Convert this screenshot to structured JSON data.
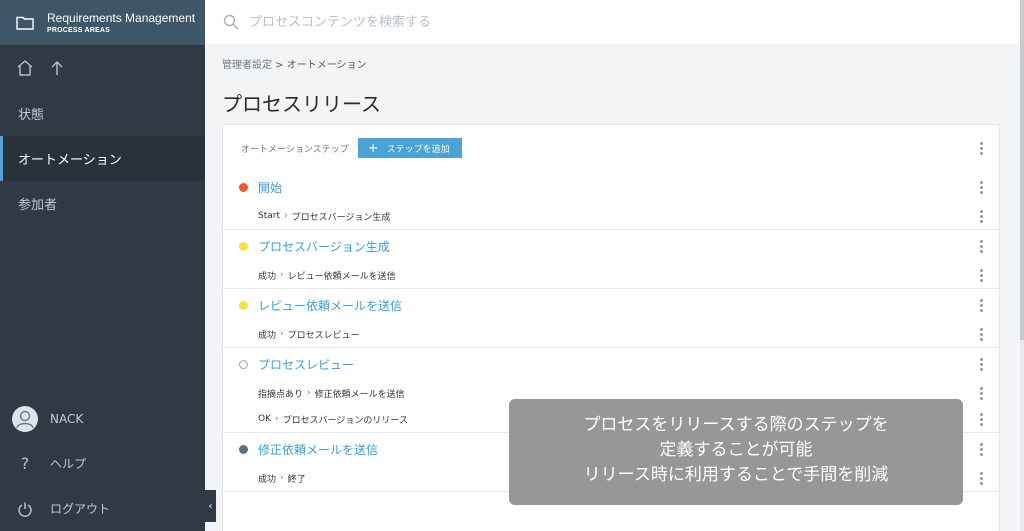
{
  "sidebar": {
    "title": "Requirements Management",
    "subtitle": "PROCESS AREAS",
    "items": [
      {
        "label": "状態"
      },
      {
        "label": "オートメーション"
      },
      {
        "label": "参加者"
      }
    ],
    "user": "NACK",
    "help": "ヘルプ",
    "logout": "ログアウト"
  },
  "search": {
    "placeholder": "プロセスコンテンツを検索する"
  },
  "breadcrumb": {
    "parent": "管理者設定",
    "sep": " > ",
    "current": "オートメーション"
  },
  "page": {
    "title": "プロセスリリース"
  },
  "card": {
    "header_label": "オートメーションステップ",
    "add_button": "ステップを追加",
    "steps": [
      {
        "title": "開始",
        "dot": "orange",
        "transitions": [
          {
            "cond": "Start",
            "target": "プロセスバージョン生成"
          }
        ]
      },
      {
        "title": "プロセスバージョン生成",
        "dot": "yellow",
        "transitions": [
          {
            "cond": "成功",
            "target": "レビュー依頼メールを送信"
          }
        ]
      },
      {
        "title": "レビュー依頼メールを送信",
        "dot": "yellow",
        "transitions": [
          {
            "cond": "成功",
            "target": "プロセスレビュー"
          }
        ]
      },
      {
        "title": "プロセスレビュー",
        "dot": "hollow",
        "transitions": [
          {
            "cond": "指摘点あり",
            "target": "修正依頼メールを送信"
          },
          {
            "cond": "OK",
            "target": "プロセスバージョンのリリース"
          }
        ]
      },
      {
        "title": "修正依頼メールを送信",
        "dot": "slate",
        "transitions": [
          {
            "cond": "成功",
            "target": "終了"
          }
        ]
      }
    ]
  },
  "overlay": {
    "line1": "プロセスをリリースする際のステップを",
    "line2": "定義することが可能",
    "line3": "リリース時に利用することで手間を削減"
  },
  "colors": {
    "sidebar_bg": "#2f3a45",
    "header_bg": "#3d5668",
    "accent": "#4aa3d4",
    "orange": "#f05a28",
    "yellow": "#f6e33c"
  }
}
